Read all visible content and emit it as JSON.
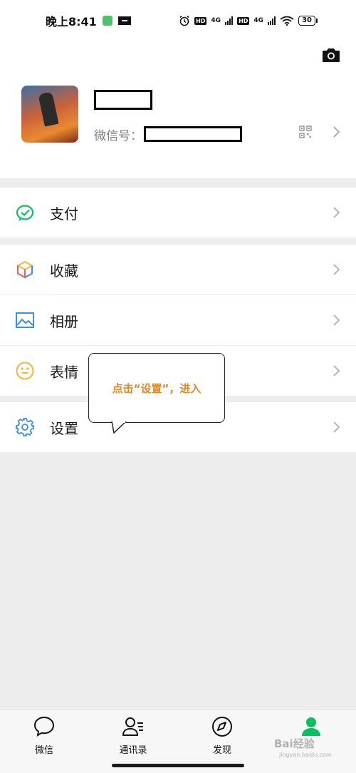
{
  "status_bar": {
    "time": "晚上8:41",
    "network_1": "4G",
    "network_2": "4G",
    "battery": "30"
  },
  "profile": {
    "wechat_id_label": "微信号："
  },
  "menu": {
    "pay_label": "支付",
    "favorites_label": "收藏",
    "album_label": "相册",
    "stickers_label": "表情",
    "settings_label": "设置"
  },
  "tooltip": {
    "text": "点击“设置”，进入"
  },
  "tabbar": {
    "chats": "微信",
    "contacts": "通讯录",
    "discover": "发现",
    "me": ""
  },
  "watermark": {
    "text": "Bai经验",
    "sub": "jingyan.baidu.com"
  },
  "colors": {
    "accent_green": "#07c160",
    "tooltip_orange": "#e0882a",
    "background": "#ededed"
  },
  "icons": {
    "camera": "camera-icon",
    "qr": "qr-code-icon",
    "pay": "wallet-check-icon",
    "favorites": "cube-icon",
    "album": "image-icon",
    "stickers": "smiley-icon",
    "settings": "gear-icon",
    "chats": "chat-bubble-icon",
    "contacts": "person-list-icon",
    "discover": "compass-icon",
    "me": "person-icon"
  }
}
